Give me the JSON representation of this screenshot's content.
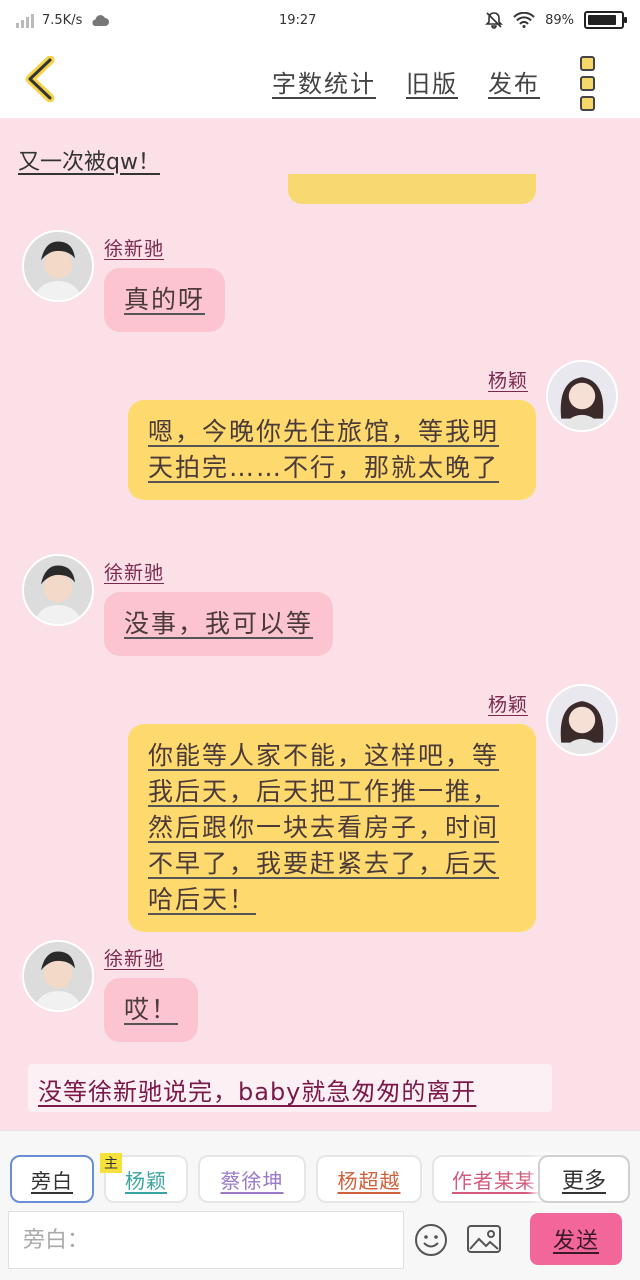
{
  "status_bar": {
    "net_speed": "7.5K/s",
    "time": "19:27",
    "battery_pct": "89%",
    "battery_level": 0.89
  },
  "nav": {
    "back_icon": "chevron-left-icon",
    "links": [
      "字数统计",
      "旧版",
      "发布"
    ],
    "more_icon": "more-vertical-icon"
  },
  "chat": {
    "title": "又一次被qw！",
    "messages": [
      {
        "side": "left",
        "name": "徐新驰",
        "text": "真的呀"
      },
      {
        "side": "right",
        "name": "杨颖",
        "text": "嗯，今晚你先住旅馆，等我明天拍完……不行，那就太晚了"
      },
      {
        "side": "left",
        "name": "徐新驰",
        "text": "没事，我可以等"
      },
      {
        "side": "right",
        "name": "杨颖",
        "text": "你能等人家不能，这样吧，等我后天，后天把工作推一推，然后跟你一块去看房子，时间不早了，我要赶紧去了，后天哈后天！"
      },
      {
        "side": "left",
        "name": "徐新驰",
        "text": "哎！"
      }
    ],
    "narration": "没等徐新驰说完，baby就急匆匆的离开"
  },
  "toolbar": {
    "roles": [
      {
        "label": "旁白",
        "color": "#555555",
        "active": true
      },
      {
        "label": "杨颖",
        "color": "#3aa5a0",
        "tag": "主"
      },
      {
        "label": "蔡徐坤",
        "color": "#9a7ac8"
      },
      {
        "label": "杨超越",
        "color": "#d0603a"
      },
      {
        "label": "作者某某君",
        "color": "#d25a7a"
      }
    ],
    "more_label": "更多",
    "input_placeholder": "旁白：",
    "send_label": "发送",
    "colors": {
      "send": "#f3669a",
      "bubble_left": "#fcc4d0",
      "bubble_right": "#fdd96e",
      "background": "#fbe0e8"
    }
  }
}
